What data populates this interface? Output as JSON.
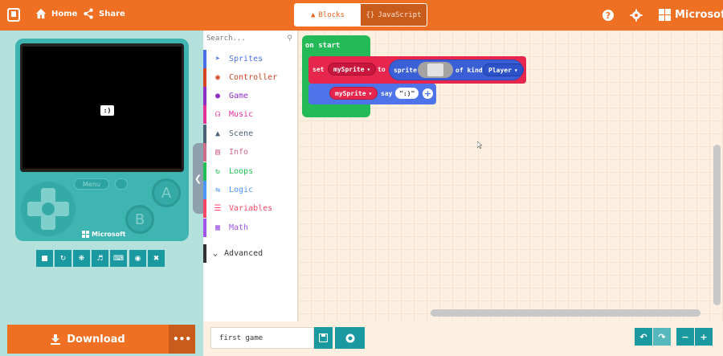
{
  "header": {
    "home_label": "Home",
    "share_label": "Share",
    "blocks_tab": "Blocks",
    "javascript_tab": "JavaScript",
    "brand": "Microsoft"
  },
  "simulator": {
    "sprite_text": ":)",
    "menu_label": "Menu",
    "button_a": "A",
    "button_b": "B",
    "device_brand": "Microsoft"
  },
  "actions": {
    "download_label": "Download",
    "more_label": "•••"
  },
  "toolbox": {
    "search_placeholder": "Search...",
    "categories": [
      {
        "label": "Sprites",
        "color": "#4b6ee8",
        "icon": "paper-plane-icon"
      },
      {
        "label": "Controller",
        "color": "#d54322",
        "icon": "gamepad-icon"
      },
      {
        "label": "Game",
        "color": "#8e2ec4",
        "icon": "circle-icon"
      },
      {
        "label": "Music",
        "color": "#e52f9c",
        "icon": "headphones-icon"
      },
      {
        "label": "Scene",
        "color": "#4a6279",
        "icon": "tree-icon"
      },
      {
        "label": "Info",
        "color": "#cf6a87",
        "icon": "id-card-icon"
      },
      {
        "label": "Loops",
        "color": "#20bf55",
        "icon": "refresh-icon"
      },
      {
        "label": "Logic",
        "color": "#4c97ff",
        "icon": "shuffle-icon"
      },
      {
        "label": "Variables",
        "color": "#ff4563",
        "icon": "list-icon"
      },
      {
        "label": "Math",
        "color": "#9f55e5",
        "icon": "calculator-icon"
      }
    ],
    "advanced_label": "Advanced"
  },
  "blocks": {
    "on_start": "on start",
    "set": "set",
    "variable": "mySprite",
    "to": "to",
    "sprite": "sprite",
    "of_kind": "of kind",
    "kind_value": "Player",
    "say": "say",
    "say_text": "\":)\""
  },
  "footer": {
    "project_name": "first game"
  }
}
